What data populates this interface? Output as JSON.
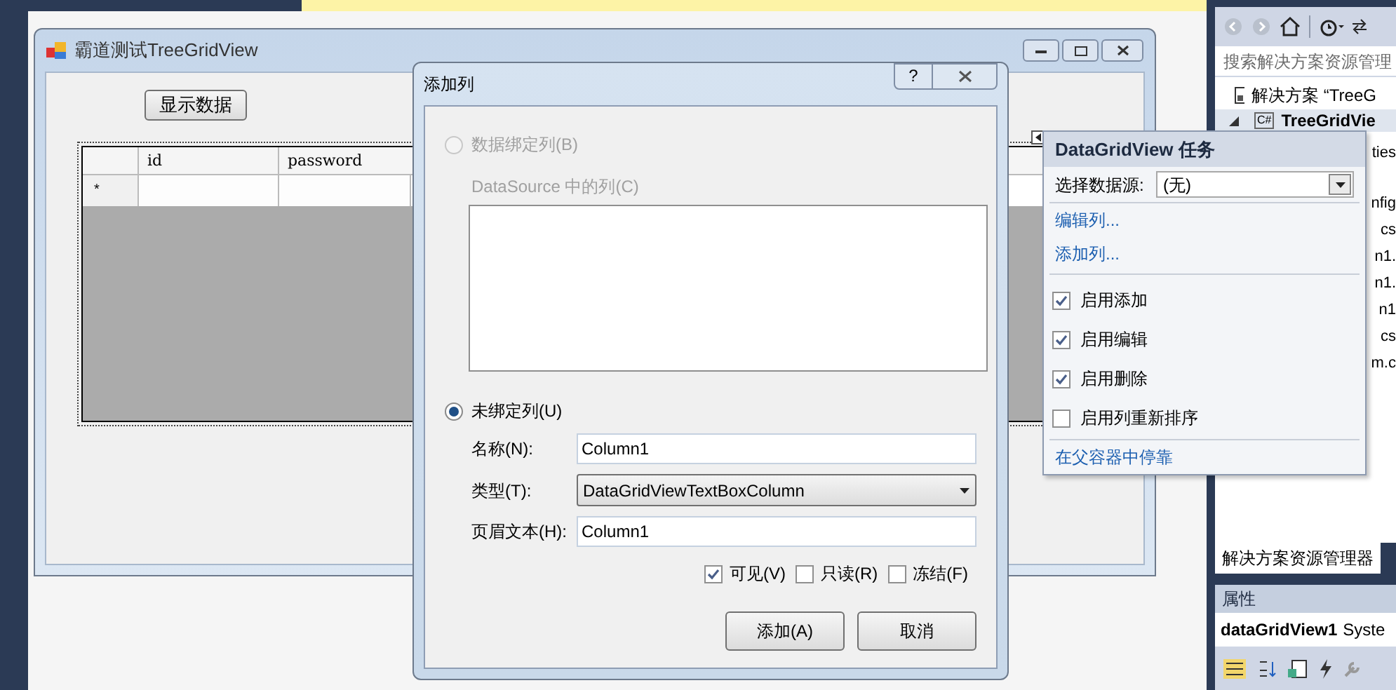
{
  "form": {
    "title": "霸道测试TreeGridView",
    "button": "显示数据",
    "grid": {
      "columns": [
        "id",
        "password"
      ],
      "new_row_marker": "*"
    }
  },
  "dialog": {
    "title": "添加列",
    "help": "?",
    "bound": {
      "label": "数据绑定列(B)",
      "selected": false,
      "disabled": true
    },
    "source_label": "DataSource 中的列(C)",
    "unbound": {
      "label": "未绑定列(U)",
      "selected": true
    },
    "fields": [
      {
        "kind": "text",
        "label": "名称(N):",
        "value": "Column1"
      },
      {
        "kind": "select",
        "label": "类型(T):",
        "value": "DataGridViewTextBoxColumn"
      },
      {
        "kind": "text",
        "label": "页眉文本(H):",
        "value": "Column1"
      }
    ],
    "checks": [
      {
        "label": "可见(V)",
        "checked": true
      },
      {
        "label": "只读(R)",
        "checked": false
      },
      {
        "label": "冻结(F)",
        "checked": false
      }
    ],
    "buttons": [
      "添加(A)",
      "取消"
    ]
  },
  "tasks": {
    "title": "DataGridView 任务",
    "datasource_label": "选择数据源:",
    "datasource_value": "(无)",
    "links": [
      "编辑列...",
      "添加列..."
    ],
    "options": [
      {
        "label": "启用添加",
        "checked": true
      },
      {
        "label": "启用编辑",
        "checked": true
      },
      {
        "label": "启用删除",
        "checked": true
      },
      {
        "label": "启用列重新排序",
        "checked": false
      }
    ],
    "dock_link": "在父容器中停靠"
  },
  "explorer": {
    "search_placeholder": "搜索解决方案资源管理",
    "solution": "解决方案 “TreeG",
    "project_badge": "C#",
    "project": "TreeGridVie",
    "items": [
      "ties",
      "nfig",
      "cs",
      "n1.",
      "n1.",
      "n1",
      "cs",
      "m.c"
    ],
    "tabs": [
      {
        "label": "解决方案资源管理器",
        "selected": true
      }
    ]
  },
  "properties": {
    "title": "属性",
    "object": "dataGridView1",
    "type": "Syste"
  }
}
